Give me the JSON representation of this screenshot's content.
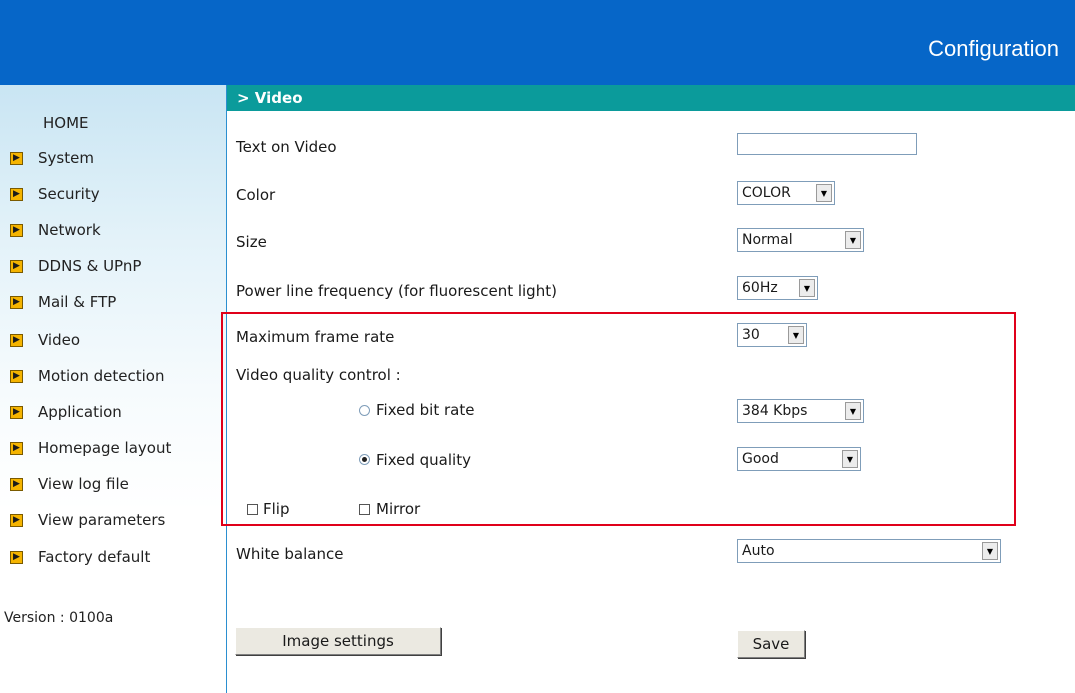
{
  "header": {
    "title": "Configuration"
  },
  "sidebar": {
    "home": "HOME",
    "items": [
      {
        "label": "System"
      },
      {
        "label": "Security"
      },
      {
        "label": "Network"
      },
      {
        "label": "DDNS & UPnP"
      },
      {
        "label": "Mail & FTP"
      },
      {
        "label": "Video"
      },
      {
        "label": "Motion detection"
      },
      {
        "label": "Application"
      },
      {
        "label": "Homepage layout"
      },
      {
        "label": "View log file"
      },
      {
        "label": "View parameters"
      },
      {
        "label": "Factory default"
      }
    ],
    "version": "Version : 0100a"
  },
  "section": {
    "title": "> Video"
  },
  "form": {
    "text_on_video": {
      "label": "Text on Video",
      "value": ""
    },
    "color": {
      "label": "Color",
      "value": "COLOR"
    },
    "size": {
      "label": "Size",
      "value": "Normal"
    },
    "power_line": {
      "label": "Power line frequency (for fluorescent light)",
      "value": "60Hz"
    },
    "max_frame_rate": {
      "label": "Maximum frame rate",
      "value": "30"
    },
    "quality_control": {
      "label": "Video quality control :"
    },
    "fixed_bit_rate": {
      "label": "Fixed bit rate",
      "value": "384 Kbps",
      "selected": false
    },
    "fixed_quality": {
      "label": "Fixed quality",
      "value": "Good",
      "selected": true
    },
    "flip": {
      "label": "Flip",
      "checked": false
    },
    "mirror": {
      "label": "Mirror",
      "checked": false
    },
    "white_balance": {
      "label": "White balance",
      "value": "Auto"
    }
  },
  "buttons": {
    "image_settings": "Image settings",
    "save": "Save"
  },
  "colors": {
    "header_bg": "#0666c8",
    "section_bg": "#0b9b9b",
    "highlight": "#e0001a",
    "nav_arrow": "#f5b400"
  }
}
